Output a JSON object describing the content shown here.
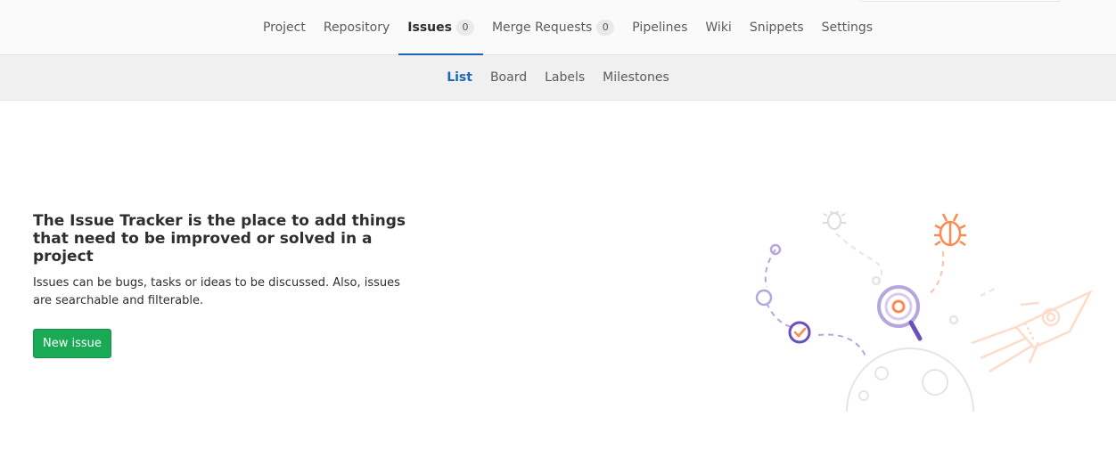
{
  "nav": {
    "tabs": [
      {
        "label": "Project"
      },
      {
        "label": "Repository"
      },
      {
        "label": "Issues",
        "count": "0"
      },
      {
        "label": "Merge Requests",
        "count": "0"
      },
      {
        "label": "Pipelines"
      },
      {
        "label": "Wiki"
      },
      {
        "label": "Snippets"
      },
      {
        "label": "Settings"
      }
    ],
    "active_tab": "Issues"
  },
  "subnav": {
    "items": [
      {
        "label": "List"
      },
      {
        "label": "Board"
      },
      {
        "label": "Labels"
      },
      {
        "label": "Milestones"
      }
    ],
    "active_item": "List"
  },
  "empty_state": {
    "title": "The Issue Tracker is the place to add things that need to be improved or solved in a project",
    "text": "Issues can be bugs, tasks or ideas to be discussed. Also, issues are searchable and filterable.",
    "button_label": "New issue"
  },
  "colors": {
    "accent_blue": "#1b69b6",
    "button_green": "#1aaa55",
    "illustration_purple": "#6b4fbb",
    "illustration_orange": "#fc8a51"
  }
}
